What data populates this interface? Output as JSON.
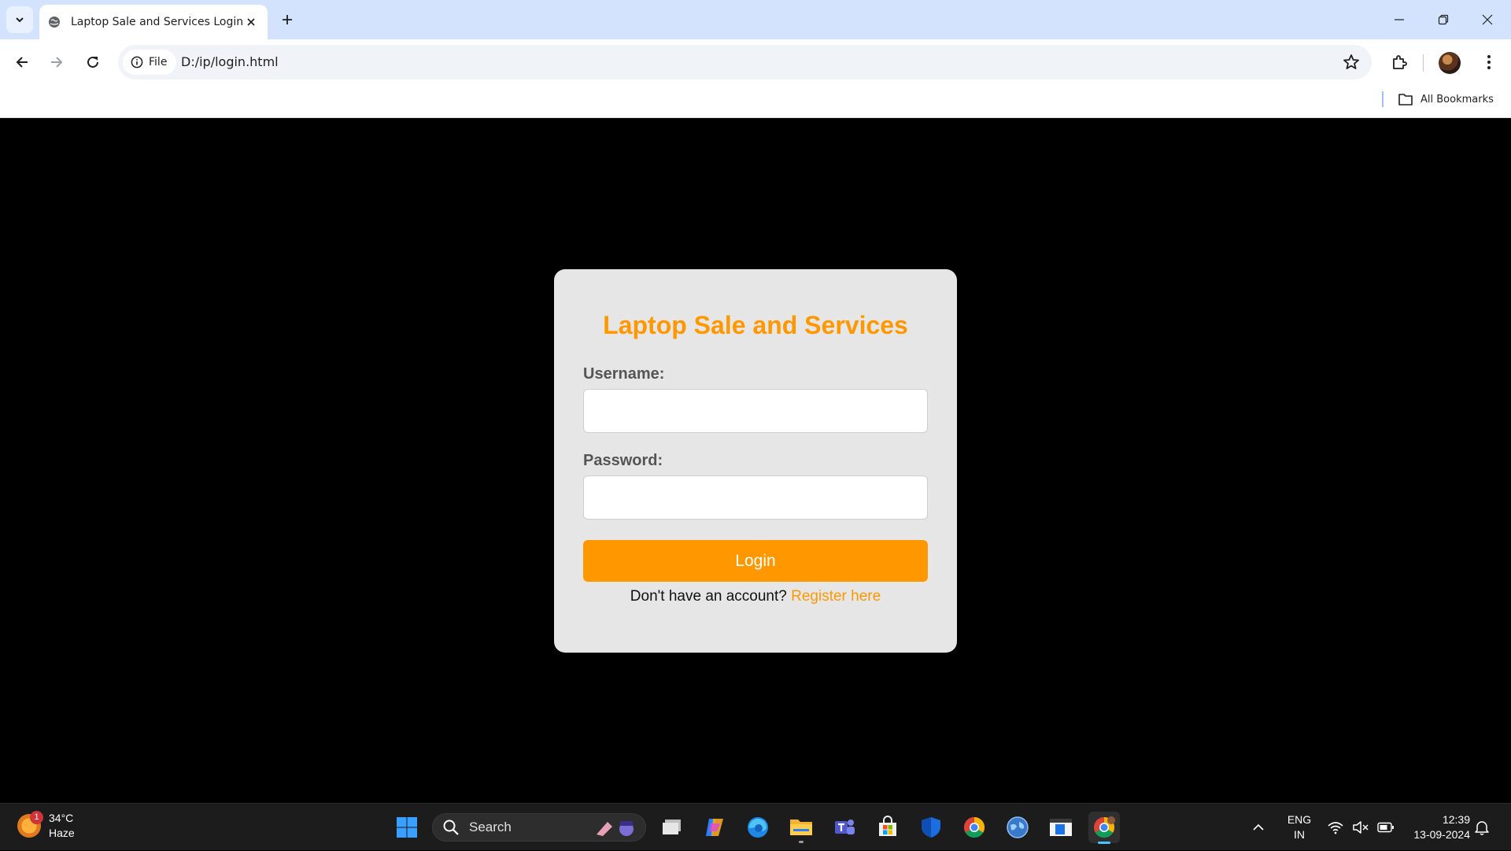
{
  "browser": {
    "tab_title": "Laptop Sale and Services Login",
    "chip_label": "File",
    "url": "D:/ip/login.html",
    "bookmarks_label": "All Bookmarks"
  },
  "page": {
    "heading": "Laptop Sale and Services",
    "username_label": "Username:",
    "username_value": "",
    "password_label": "Password:",
    "password_value": "",
    "login_button": "Login",
    "register_prompt": "Don't have an account?",
    "register_link": "Register here",
    "accent_color": "#ff9800",
    "card_color": "#e6e6e6"
  },
  "taskbar": {
    "weather_temp": "34°C",
    "weather_desc": "Haze",
    "weather_badge": "1",
    "search_label": "Search",
    "apps": [
      "windows-start-icon",
      "task-view-icon",
      "copilot-icon",
      "edge-icon",
      "file-explorer-icon",
      "teams-icon",
      "microsoft-store-icon",
      "defender-icon",
      "chrome-icon",
      "network-globe-icon",
      "app-window-icon",
      "chrome-active-icon"
    ],
    "lang_line1": "ENG",
    "lang_line2": "IN",
    "time": "12:39",
    "date": "13-09-2024"
  }
}
